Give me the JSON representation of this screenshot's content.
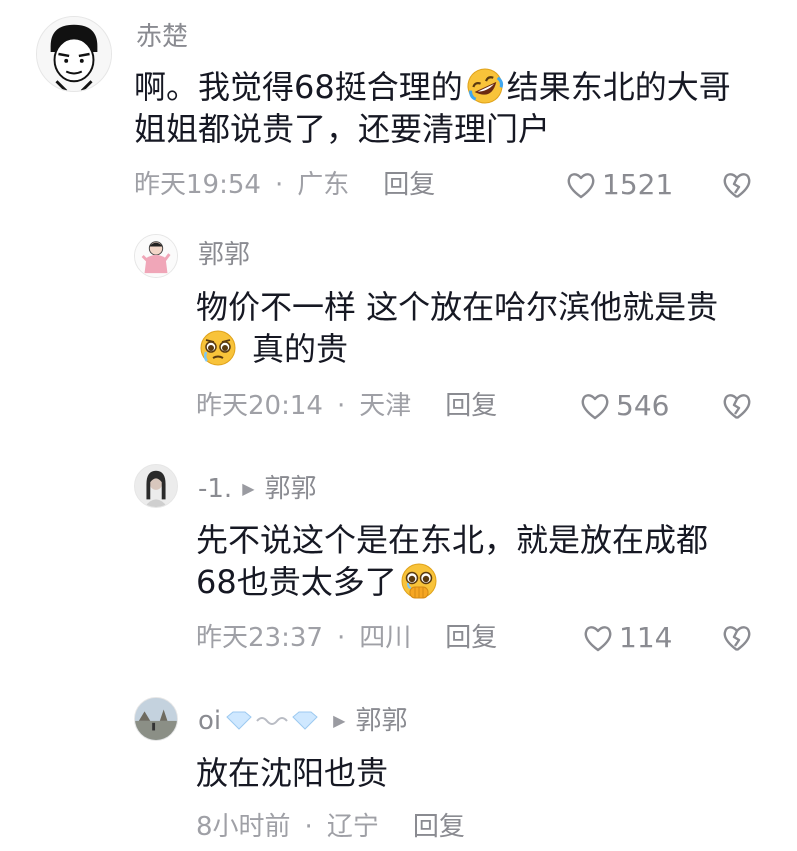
{
  "comments": [
    {
      "username": "赤楚",
      "text_line1_a": "啊。我觉得68挺合理的",
      "text_line1_b": "结果东北的大哥",
      "text_line2": "姐姐都说贵了，还要清理门户",
      "emoji": "rofl-emoji",
      "time": "昨天19:54",
      "location": "广东",
      "reply_label": "回复",
      "likes": "1521"
    },
    {
      "username": "郭郭",
      "text_line1": "物价不一样 这个放在哈尔滨他就是贵",
      "text_line2": "真的贵",
      "emoji": "pleading-face-emoji",
      "time": "昨天20:14",
      "location": "天津",
      "reply_label": "回复",
      "likes": "546"
    },
    {
      "username": "-1.",
      "reply_to": "郭郭",
      "text_line1": "先不说这个是在东北，就是放在成都",
      "text_line2": "68也贵太多了",
      "emoji": "holding-back-tears-emoji",
      "time": "昨天23:37",
      "location": "四川",
      "reply_label": "回复",
      "likes": "114"
    },
    {
      "username": "oi",
      "username_decor": "gem-wave-decoration",
      "reply_to": "郭郭",
      "text_line1": "放在沈阳也贵",
      "time": "8小时前",
      "location": "辽宁",
      "reply_label": "回复"
    }
  ],
  "meta_separator": "·",
  "colors": {
    "text_primary": "#161823",
    "text_secondary": "#8a8b91",
    "text_meta": "#9fa0a6",
    "background": "#ffffff"
  },
  "icons": {
    "like": "heart-outline-icon",
    "dislike": "broken-heart-icon",
    "reply_arrow": "play-triangle-icon"
  }
}
